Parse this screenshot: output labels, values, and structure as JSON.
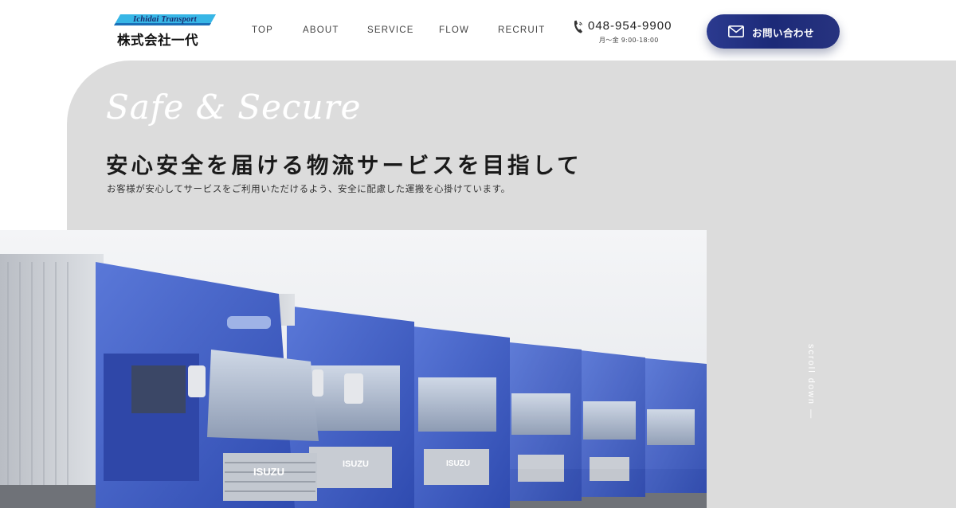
{
  "header": {
    "logo": {
      "banner_text": "Ichidai Transport",
      "company_name": "株式会社一代"
    },
    "nav": [
      {
        "label": "TOP"
      },
      {
        "label": "ABOUT"
      },
      {
        "label": "SERVICE"
      },
      {
        "label": "FLOW"
      },
      {
        "label": "RECRUIT"
      }
    ],
    "phone": {
      "icon": "phone-icon",
      "number": "048-954-9900",
      "hours": "月～金 9:00-18:00"
    },
    "contact_button": {
      "icon": "mail-icon",
      "label": "お問い合わせ"
    }
  },
  "hero": {
    "script_title": "Safe & Secure",
    "heading": "安心安全を届ける物流サービスを目指して",
    "subtext": "お客様が安心してサービスをご利用いただけるよう、安全に配慮した運搬を心掛けています。",
    "scroll_label": "scroll down —",
    "photo_marks": {
      "brand_on_grille": "ISUZU"
    }
  },
  "colors": {
    "brand_navy": "#1c2a78",
    "hero_gray": "#dcdcdc",
    "truck_blue": "#3d5bc4",
    "logo_cyan": "#37b6e6"
  }
}
